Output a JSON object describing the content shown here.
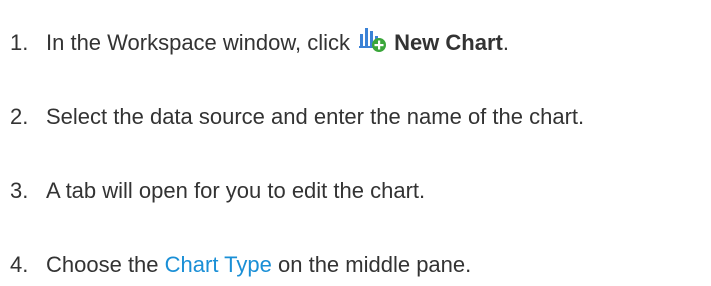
{
  "steps": [
    {
      "number": "1.",
      "text_before": "In the Workspace window, click",
      "icon": "new-chart-icon",
      "bold_text": "New Chart",
      "text_after": "."
    },
    {
      "number": "2.",
      "text": "Select the data source and enter the name of the chart."
    },
    {
      "number": "3.",
      "text": "A tab will open for you to edit the chart."
    },
    {
      "number": "4.",
      "text_before": "Choose the",
      "link_text": "Chart Type",
      "text_after": "on the middle pane."
    }
  ],
  "colors": {
    "text": "#333333",
    "link": "#1a8fd6",
    "icon_bars": "#3b82d6",
    "icon_plus": "#3aa63a"
  }
}
